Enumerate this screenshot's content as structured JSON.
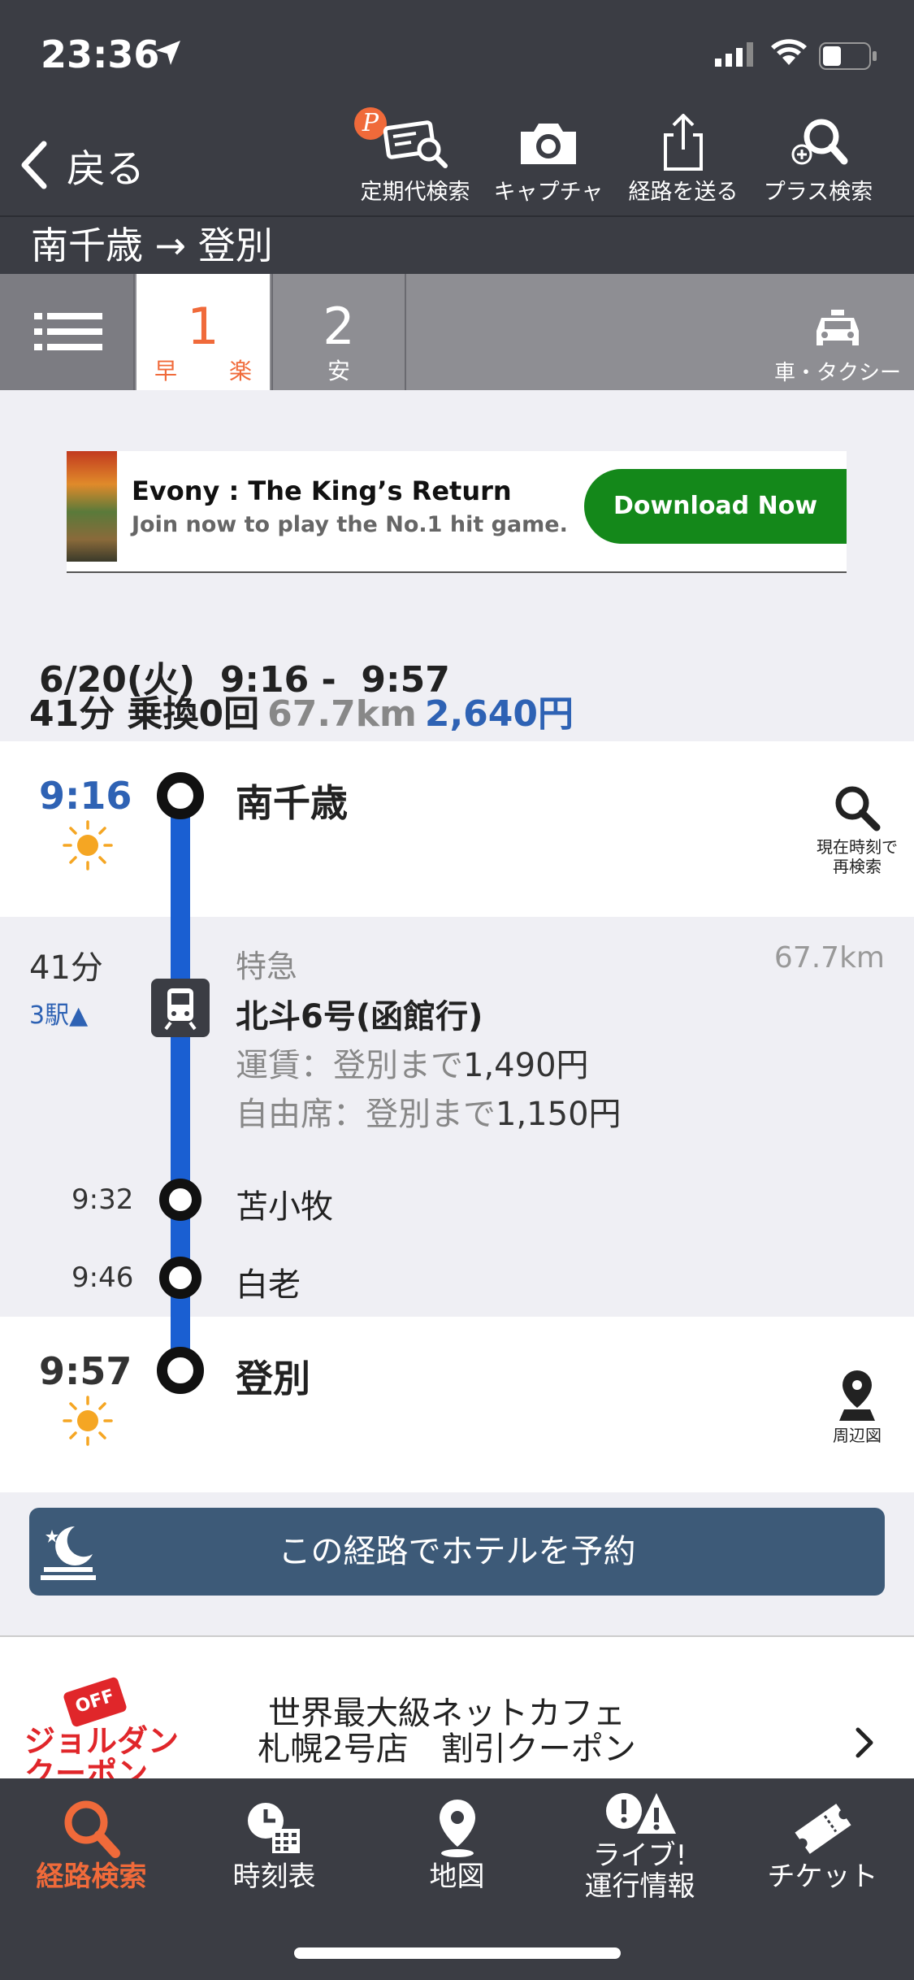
{
  "status": {
    "time": "23:36"
  },
  "header": {
    "back_label": "戻る",
    "toolbar": [
      {
        "label": "定期代検索",
        "icon": "commuter-pass-search-icon"
      },
      {
        "label": "キャプチャ",
        "icon": "camera-icon"
      },
      {
        "label": "経路を送る",
        "icon": "share-icon"
      },
      {
        "label": "プラス検索",
        "icon": "plus-search-icon"
      }
    ],
    "route_title": "南千歳 → 登別",
    "p_badge": "P"
  },
  "tabs": {
    "tab1_num": "1",
    "tab1_sub_a": "早",
    "tab1_sub_b": "楽",
    "tab2_num": "2",
    "tab2_sub": "安",
    "taxi_label": "車・タクシー"
  },
  "ad": {
    "title": "Evony : The King’s Return",
    "desc": "Join now to play the No.1 hit game.",
    "button": "Download Now"
  },
  "summary": {
    "date_time": "6/20(火)  9:16 -  9:57",
    "duration_transfers": "41分 乗換0回",
    "distance": "67.7km",
    "fare": "2,640円"
  },
  "itinerary": {
    "departure": {
      "time": "9:16",
      "station": "南千歳",
      "research_label_1": "現在時刻で",
      "research_label_2": "再検索"
    },
    "ride": {
      "duration": "41分",
      "stops": "3駅▲",
      "type": "特急",
      "distance": "67.7km",
      "train_name": "北斗6号(函館行)",
      "fare_label": "運賃：登別まで",
      "fare_value": "1,490円",
      "seat_label": "自由席：登別まで",
      "seat_value": "1,150円",
      "intermediate": [
        {
          "time": "9:32",
          "station": "苫小牧"
        },
        {
          "time": "9:46",
          "station": "白老"
        }
      ]
    },
    "arrival": {
      "time": "9:57",
      "station": "登別",
      "map_label": "周辺図"
    }
  },
  "hotel_button": "この経路でホテルを予約",
  "coupon": {
    "off_tag": "OFF",
    "brand_line_1": "ジョルダン",
    "brand_line_2": "クーポン",
    "text_line_1": "世界最大級ネットカフェ",
    "text_line_2": "札幌2号店　割引クーポン"
  },
  "bottom_tabs": [
    {
      "label": "経路検索",
      "icon": "route-search-icon",
      "active": true
    },
    {
      "label": "時刻表",
      "icon": "timetable-icon"
    },
    {
      "label": "地図",
      "icon": "map-pin-icon"
    },
    {
      "label_1": "ライブ!",
      "label_2": "運行情報",
      "icon": "live-info-icon"
    },
    {
      "label": "チケット",
      "icon": "ticket-icon"
    }
  ],
  "colors": {
    "header_bg": "#3b3d44",
    "accent": "#f06a3a",
    "route_line": "#1a5fd2",
    "fare_blue": "#2e62b4",
    "hotel_bg": "#3d5a78",
    "ad_button": "#14881a"
  }
}
